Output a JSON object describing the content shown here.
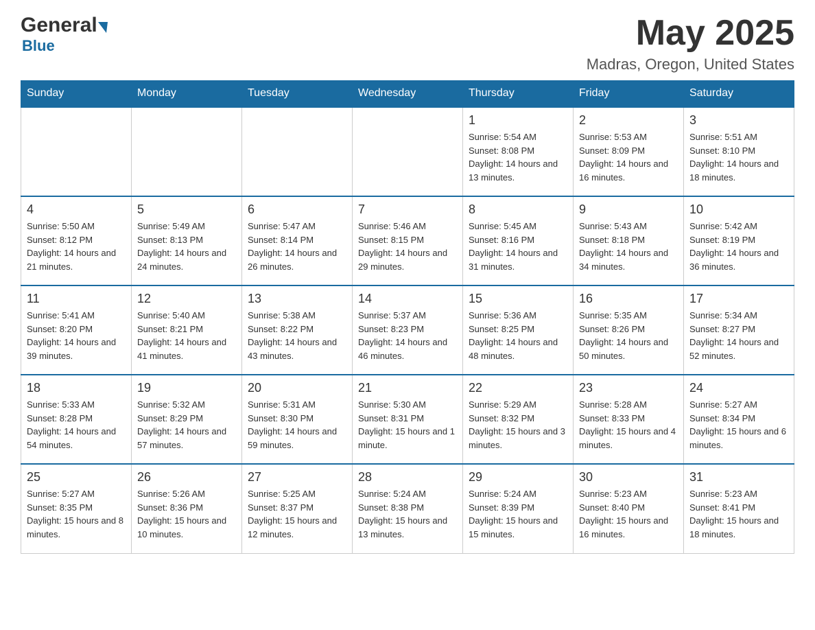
{
  "logo": {
    "general": "General",
    "blue": "Blue",
    "triangle": "▶"
  },
  "header": {
    "month": "May 2025",
    "location": "Madras, Oregon, United States"
  },
  "weekdays": [
    "Sunday",
    "Monday",
    "Tuesday",
    "Wednesday",
    "Thursday",
    "Friday",
    "Saturday"
  ],
  "weeks": [
    [
      {
        "day": "",
        "info": ""
      },
      {
        "day": "",
        "info": ""
      },
      {
        "day": "",
        "info": ""
      },
      {
        "day": "",
        "info": ""
      },
      {
        "day": "1",
        "info": "Sunrise: 5:54 AM\nSunset: 8:08 PM\nDaylight: 14 hours and 13 minutes."
      },
      {
        "day": "2",
        "info": "Sunrise: 5:53 AM\nSunset: 8:09 PM\nDaylight: 14 hours and 16 minutes."
      },
      {
        "day": "3",
        "info": "Sunrise: 5:51 AM\nSunset: 8:10 PM\nDaylight: 14 hours and 18 minutes."
      }
    ],
    [
      {
        "day": "4",
        "info": "Sunrise: 5:50 AM\nSunset: 8:12 PM\nDaylight: 14 hours and 21 minutes."
      },
      {
        "day": "5",
        "info": "Sunrise: 5:49 AM\nSunset: 8:13 PM\nDaylight: 14 hours and 24 minutes."
      },
      {
        "day": "6",
        "info": "Sunrise: 5:47 AM\nSunset: 8:14 PM\nDaylight: 14 hours and 26 minutes."
      },
      {
        "day": "7",
        "info": "Sunrise: 5:46 AM\nSunset: 8:15 PM\nDaylight: 14 hours and 29 minutes."
      },
      {
        "day": "8",
        "info": "Sunrise: 5:45 AM\nSunset: 8:16 PM\nDaylight: 14 hours and 31 minutes."
      },
      {
        "day": "9",
        "info": "Sunrise: 5:43 AM\nSunset: 8:18 PM\nDaylight: 14 hours and 34 minutes."
      },
      {
        "day": "10",
        "info": "Sunrise: 5:42 AM\nSunset: 8:19 PM\nDaylight: 14 hours and 36 minutes."
      }
    ],
    [
      {
        "day": "11",
        "info": "Sunrise: 5:41 AM\nSunset: 8:20 PM\nDaylight: 14 hours and 39 minutes."
      },
      {
        "day": "12",
        "info": "Sunrise: 5:40 AM\nSunset: 8:21 PM\nDaylight: 14 hours and 41 minutes."
      },
      {
        "day": "13",
        "info": "Sunrise: 5:38 AM\nSunset: 8:22 PM\nDaylight: 14 hours and 43 minutes."
      },
      {
        "day": "14",
        "info": "Sunrise: 5:37 AM\nSunset: 8:23 PM\nDaylight: 14 hours and 46 minutes."
      },
      {
        "day": "15",
        "info": "Sunrise: 5:36 AM\nSunset: 8:25 PM\nDaylight: 14 hours and 48 minutes."
      },
      {
        "day": "16",
        "info": "Sunrise: 5:35 AM\nSunset: 8:26 PM\nDaylight: 14 hours and 50 minutes."
      },
      {
        "day": "17",
        "info": "Sunrise: 5:34 AM\nSunset: 8:27 PM\nDaylight: 14 hours and 52 minutes."
      }
    ],
    [
      {
        "day": "18",
        "info": "Sunrise: 5:33 AM\nSunset: 8:28 PM\nDaylight: 14 hours and 54 minutes."
      },
      {
        "day": "19",
        "info": "Sunrise: 5:32 AM\nSunset: 8:29 PM\nDaylight: 14 hours and 57 minutes."
      },
      {
        "day": "20",
        "info": "Sunrise: 5:31 AM\nSunset: 8:30 PM\nDaylight: 14 hours and 59 minutes."
      },
      {
        "day": "21",
        "info": "Sunrise: 5:30 AM\nSunset: 8:31 PM\nDaylight: 15 hours and 1 minute."
      },
      {
        "day": "22",
        "info": "Sunrise: 5:29 AM\nSunset: 8:32 PM\nDaylight: 15 hours and 3 minutes."
      },
      {
        "day": "23",
        "info": "Sunrise: 5:28 AM\nSunset: 8:33 PM\nDaylight: 15 hours and 4 minutes."
      },
      {
        "day": "24",
        "info": "Sunrise: 5:27 AM\nSunset: 8:34 PM\nDaylight: 15 hours and 6 minutes."
      }
    ],
    [
      {
        "day": "25",
        "info": "Sunrise: 5:27 AM\nSunset: 8:35 PM\nDaylight: 15 hours and 8 minutes."
      },
      {
        "day": "26",
        "info": "Sunrise: 5:26 AM\nSunset: 8:36 PM\nDaylight: 15 hours and 10 minutes."
      },
      {
        "day": "27",
        "info": "Sunrise: 5:25 AM\nSunset: 8:37 PM\nDaylight: 15 hours and 12 minutes."
      },
      {
        "day": "28",
        "info": "Sunrise: 5:24 AM\nSunset: 8:38 PM\nDaylight: 15 hours and 13 minutes."
      },
      {
        "day": "29",
        "info": "Sunrise: 5:24 AM\nSunset: 8:39 PM\nDaylight: 15 hours and 15 minutes."
      },
      {
        "day": "30",
        "info": "Sunrise: 5:23 AM\nSunset: 8:40 PM\nDaylight: 15 hours and 16 minutes."
      },
      {
        "day": "31",
        "info": "Sunrise: 5:23 AM\nSunset: 8:41 PM\nDaylight: 15 hours and 18 minutes."
      }
    ]
  ]
}
